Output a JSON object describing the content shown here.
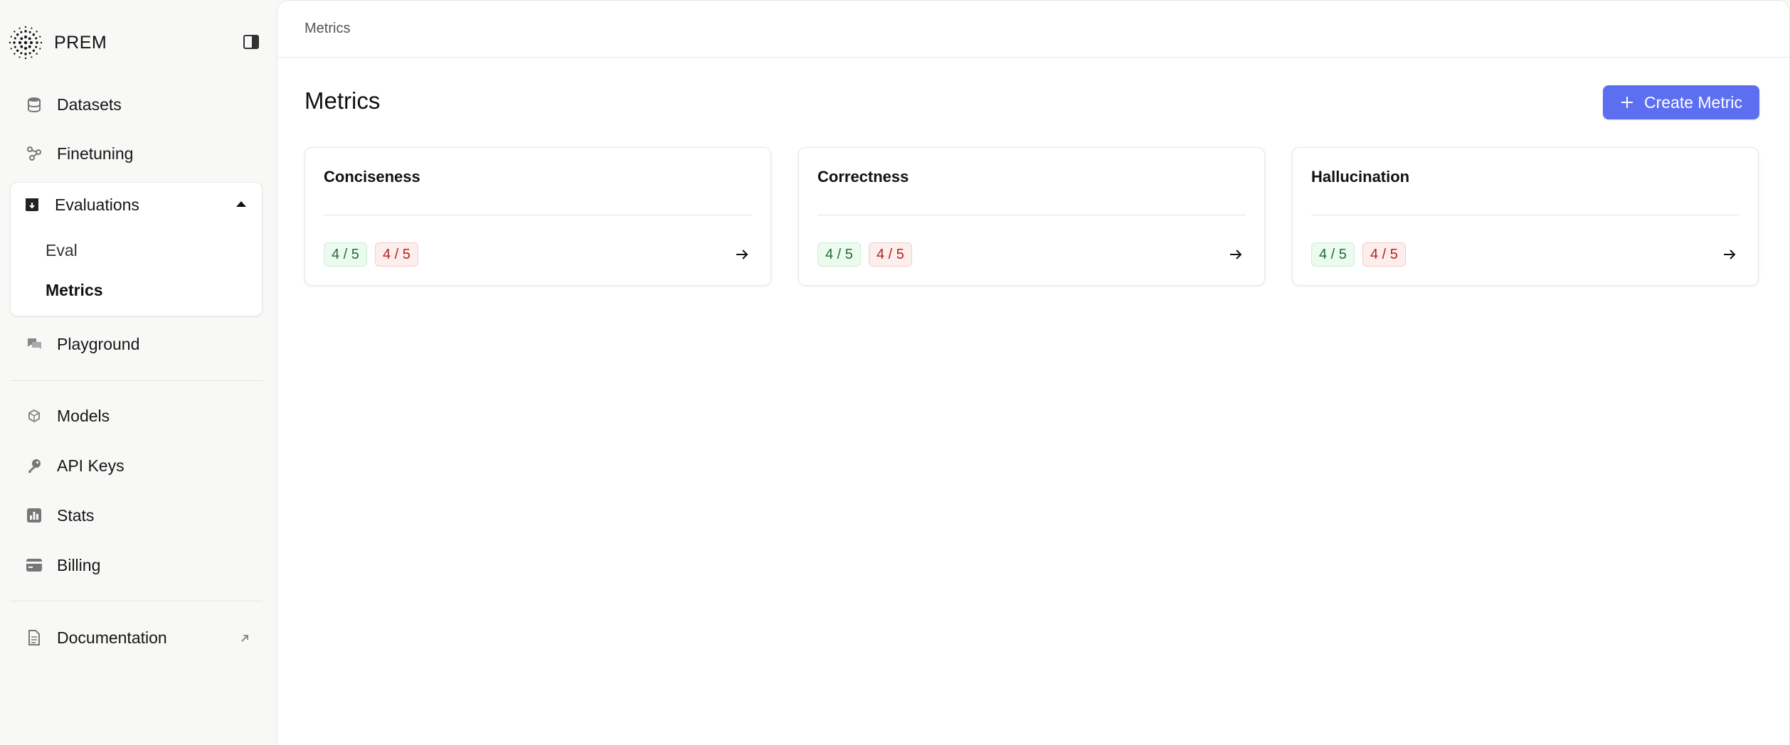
{
  "brand": {
    "name": "PREM"
  },
  "sidebar": {
    "items": [
      {
        "label": "Datasets",
        "icon": "database-icon"
      },
      {
        "label": "Finetuning",
        "icon": "finetune-icon"
      },
      {
        "label": "Evaluations",
        "icon": "evaluations-icon",
        "expanded": true,
        "children": [
          {
            "label": "Eval"
          },
          {
            "label": "Metrics",
            "active": true
          }
        ]
      },
      {
        "label": "Playground",
        "icon": "chat-icon"
      },
      {
        "label": "Models",
        "icon": "cube-icon"
      },
      {
        "label": "API Keys",
        "icon": "key-icon"
      },
      {
        "label": "Stats",
        "icon": "stats-icon"
      },
      {
        "label": "Billing",
        "icon": "card-icon"
      },
      {
        "label": "Documentation",
        "icon": "document-icon",
        "external": true
      }
    ]
  },
  "header": {
    "breadcrumb": "Metrics"
  },
  "main": {
    "title": "Metrics",
    "create_button": "Create Metric",
    "cards": [
      {
        "title": "Conciseness",
        "pass": "4 / 5",
        "fail": "4 / 5"
      },
      {
        "title": "Correctness",
        "pass": "4 / 5",
        "fail": "4 / 5"
      },
      {
        "title": "Hallucination",
        "pass": "4 / 5",
        "fail": "4 / 5"
      }
    ]
  },
  "colors": {
    "accent": "#5c6ff1",
    "pass_text": "#236b35",
    "fail_text": "#b42318",
    "sidebar_bg": "#f8f8f7"
  }
}
